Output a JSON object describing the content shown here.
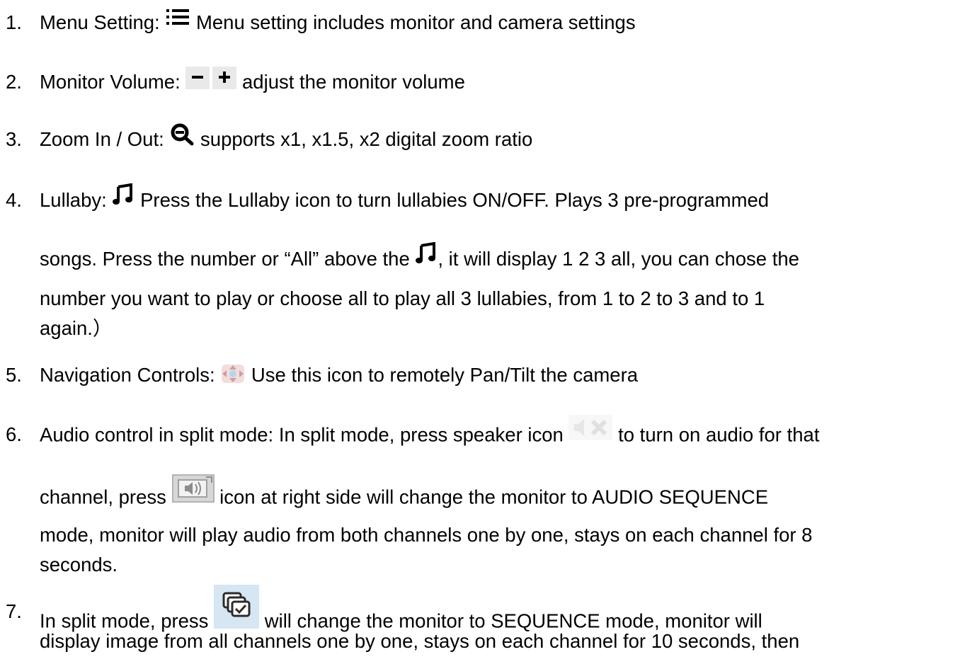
{
  "items": [
    {
      "number": "1.",
      "title": "Menu Setting:",
      "icon": "list-menu-icon",
      "text": "Menu setting includes monitor and camera settings"
    },
    {
      "number": "2.",
      "title": "Monitor Volume:",
      "icons": [
        "minus-icon",
        "plus-icon"
      ],
      "text": "adjust the monitor volume"
    },
    {
      "number": "3.",
      "title": "Zoom In / Out:",
      "icon": "zoom-icon",
      "text": "supports x1, x1.5, x2 digital zoom ratio"
    },
    {
      "number": "4.",
      "title": "Lullaby:",
      "icon": "music-note-icon",
      "text_1": "Press the Lullaby icon to turn lullabies ON/OFF. Plays 3 pre-programmed",
      "text_2a": "songs. Press the number or “All” above the",
      "text_2b": ", it will display 1 2 3 all, you can chose the",
      "text_3": "number you want to play or choose all to play all 3 lullabies, from 1 to 2 to 3 and to 1",
      "text_4": "again.）"
    },
    {
      "number": "5.",
      "title": "Navigation Controls:",
      "icon": "pan-tilt-icon",
      "text": "Use this icon to remotely Pan/Tilt the camera"
    },
    {
      "number": "6.",
      "text_1a": "Audio control in split mode: In split mode, press speaker icon",
      "icon_1": "speaker-mute-icon",
      "text_1b": "to turn on audio for that",
      "text_2a": "channel, press",
      "icon_2": "audio-sequence-icon",
      "text_2b": "icon at right side will change the monitor to AUDIO SEQUENCE",
      "text_3": "mode, monitor will play audio from both channels one by one, stays on each channel for 8",
      "text_4": "seconds."
    },
    {
      "number": "7.",
      "text_1a": "In split mode, press",
      "icon": "sequence-icon",
      "text_1b": "will change the monitor to SEQUENCE mode, monitor will",
      "text_2": "display image from all channels one by one, stays on each channel for 10 seconds, then"
    }
  ]
}
